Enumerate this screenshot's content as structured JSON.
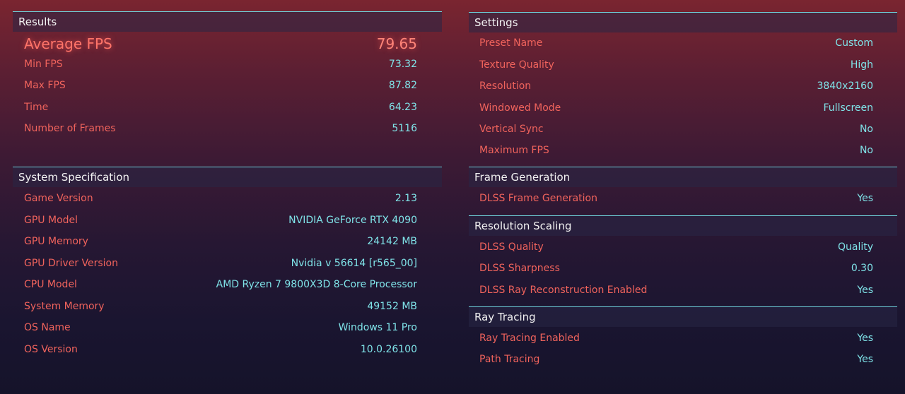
{
  "results": {
    "title": "Results",
    "average_fps": {
      "label": "Average FPS",
      "value": "79.65"
    },
    "rows": [
      {
        "label": "Min FPS",
        "value": "73.32"
      },
      {
        "label": "Max FPS",
        "value": "87.82"
      },
      {
        "label": "Time",
        "value": "64.23"
      },
      {
        "label": "Number of Frames",
        "value": "5116"
      }
    ]
  },
  "system": {
    "title": "System Specification",
    "rows": [
      {
        "label": "Game Version",
        "value": "2.13"
      },
      {
        "label": "GPU Model",
        "value": "NVIDIA GeForce RTX 4090"
      },
      {
        "label": "GPU Memory",
        "value": "24142 MB"
      },
      {
        "label": "GPU Driver Version",
        "value": "Nvidia v 56614 [r565_00]"
      },
      {
        "label": "CPU Model",
        "value": "AMD Ryzen 7 9800X3D 8-Core Processor"
      },
      {
        "label": "System Memory",
        "value": "49152 MB"
      },
      {
        "label": "OS Name",
        "value": "Windows 11 Pro"
      },
      {
        "label": "OS Version",
        "value": "10.0.26100"
      }
    ]
  },
  "settings": {
    "title": "Settings",
    "rows": [
      {
        "label": "Preset Name",
        "value": "Custom"
      },
      {
        "label": "Texture Quality",
        "value": "High"
      },
      {
        "label": "Resolution",
        "value": "3840x2160"
      },
      {
        "label": "Windowed Mode",
        "value": "Fullscreen"
      },
      {
        "label": "Vertical Sync",
        "value": "No"
      },
      {
        "label": "Maximum FPS",
        "value": "No"
      }
    ]
  },
  "frame_generation": {
    "title": "Frame Generation",
    "rows": [
      {
        "label": "DLSS Frame Generation",
        "value": "Yes"
      }
    ]
  },
  "resolution_scaling": {
    "title": "Resolution Scaling",
    "rows": [
      {
        "label": "DLSS Quality",
        "value": "Quality"
      },
      {
        "label": "DLSS Sharpness",
        "value": "0.30"
      },
      {
        "label": "DLSS Ray Reconstruction Enabled",
        "value": "Yes"
      }
    ]
  },
  "ray_tracing": {
    "title": "Ray Tracing",
    "rows": [
      {
        "label": "Ray Tracing Enabled",
        "value": "Yes"
      },
      {
        "label": "Path Tracing",
        "value": "Yes"
      }
    ]
  },
  "colors": {
    "label": "#f0635c",
    "value": "#7fe3e8",
    "divider": "#6fd3dc"
  }
}
